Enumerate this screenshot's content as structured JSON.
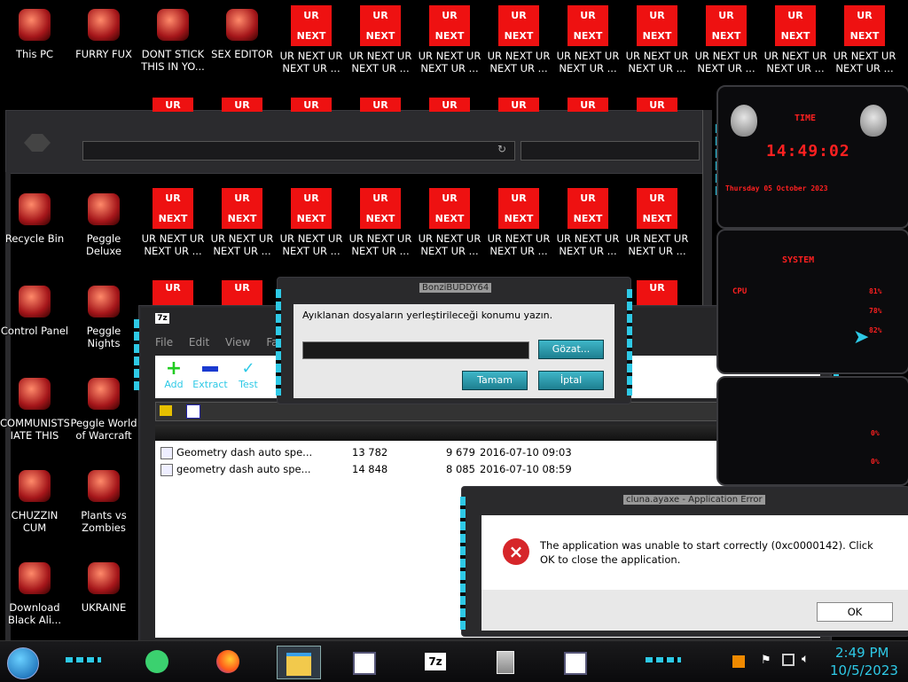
{
  "desktop": {
    "row1": [
      {
        "label": "This PC",
        "icon": "monitor-icon"
      },
      {
        "label": "FURRY FUX",
        "icon": "firefox-icon"
      },
      {
        "label": "DONT STICK\nTHIS IN YO...",
        "icon": "vlc-cone-icon"
      },
      {
        "label": "SEX EDITOR",
        "icon": "hxd-icon"
      }
    ],
    "ur_top": "UR",
    "ur_bottom": "NEXT",
    "ur_label": "UR NEXT UR\nNEXT UR ...",
    "col1": [
      {
        "label": "Recycle Bin",
        "icon": "recycle-bin-icon"
      },
      {
        "label": "Control Panel",
        "icon": "control-panel-icon"
      },
      {
        "label": "COMMUNISTS\nIATE THIS G...",
        "icon": "money-bag-icon"
      },
      {
        "label": "CHUZZIN\nCUM",
        "icon": "chuzzle-icon"
      },
      {
        "label": "Download\nBlack Ali...",
        "icon": "black-alien-icon"
      }
    ],
    "col2": [
      {
        "label": "Peggle Deluxe",
        "icon": "peggle-icon"
      },
      {
        "label": "Peggle Nights\nDeluxe",
        "icon": "peggle-nights-icon"
      },
      {
        "label": "Peggle World\nof Warcraft",
        "icon": "peggle-wow-icon"
      },
      {
        "label": "Plants vs\nZombies",
        "icon": "plants-vs-zombies-icon"
      },
      {
        "label": "UKRAINE",
        "icon": "radiation-icon"
      }
    ]
  },
  "sevenzip": {
    "title": "7z",
    "menu": [
      "File",
      "Edit",
      "View",
      "Fa"
    ],
    "toolbar": {
      "add": "Add",
      "extract": "Extract",
      "test": "Test"
    },
    "files": [
      {
        "name": "Geometry dash auto spe...",
        "size": "13 782",
        "packed": "9 679",
        "modified": "2016-07-10 09:03"
      },
      {
        "name": "geometry dash auto spe...",
        "size": "14 848",
        "packed": "8 085",
        "modified": "2016-07-10 08:59"
      }
    ]
  },
  "extract_dialog": {
    "title": "BonziBUDDY64",
    "prompt": "Ayıklanan dosyaların yerleştirileceği konumu yazın.",
    "path_value": "",
    "browse": "Gözat...",
    "ok": "Tamam",
    "cancel": "İptal"
  },
  "error_dialog": {
    "title": "cluna.ayaxe - Application Error",
    "message": "The application was unable to start correctly (0xc0000142). Click OK to close the application.",
    "ok": "OK"
  },
  "gadget": {
    "time_label": "TIME",
    "time": "14:49:02",
    "date": "Thursday 05 October 2023",
    "system_label": "SYSTEM",
    "cpu_label": "CPU",
    "cpu_values": [
      "81%",
      "78%",
      "82%"
    ],
    "lower_values": [
      "0%",
      "0%"
    ]
  },
  "taskbar": {
    "clock_time": "2:49 PM",
    "clock_date": "10/5/2023",
    "apps": [
      "green-chat-icon",
      "firefox-icon",
      "file-explorer-icon",
      "notepad-icon",
      "7zip-icon",
      "setup-icon",
      "notepad-icon"
    ],
    "colors": {
      "accent": "#2ec9e6",
      "red": "#ee1111"
    }
  }
}
